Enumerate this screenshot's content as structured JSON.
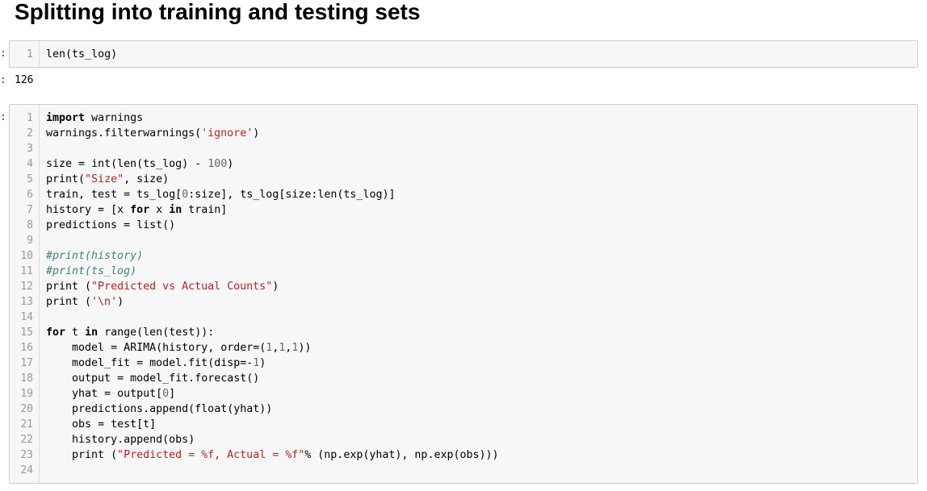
{
  "heading": "Splitting into training and testing sets",
  "cells": [
    {
      "prompt": ":",
      "lines": [
        {
          "n": "1",
          "code": "len(ts_log)"
        }
      ]
    },
    {
      "prompt": ":",
      "lines": [
        {
          "n": "1",
          "code": "import warnings"
        },
        {
          "n": "2",
          "code": "warnings.filterwarnings('ignore')"
        },
        {
          "n": "3",
          "code": ""
        },
        {
          "n": "4",
          "code": "size = int(len(ts_log) - 100)"
        },
        {
          "n": "5",
          "code": "print(\"Size\", size)"
        },
        {
          "n": "6",
          "code": "train, test = ts_log[0:size], ts_log[size:len(ts_log)]"
        },
        {
          "n": "7",
          "code": "history = [x for x in train]"
        },
        {
          "n": "8",
          "code": "predictions = list()"
        },
        {
          "n": "9",
          "code": ""
        },
        {
          "n": "10",
          "code": "#print(history)"
        },
        {
          "n": "11",
          "code": "#print(ts_log)"
        },
        {
          "n": "12",
          "code": "print (\"Predicted vs Actual Counts\")"
        },
        {
          "n": "13",
          "code": "print ('\\n')"
        },
        {
          "n": "14",
          "code": ""
        },
        {
          "n": "15",
          "code": "for t in range(len(test)):"
        },
        {
          "n": "16",
          "code": "    model = ARIMA(history, order=(1,1,1))"
        },
        {
          "n": "17",
          "code": "    model_fit = model.fit(disp=-1)"
        },
        {
          "n": "18",
          "code": "    output = model_fit.forecast()"
        },
        {
          "n": "19",
          "code": "    yhat = output[0]"
        },
        {
          "n": "20",
          "code": "    predictions.append(float(yhat))"
        },
        {
          "n": "21",
          "code": "    obs = test[t]"
        },
        {
          "n": "22",
          "code": "    history.append(obs)"
        },
        {
          "n": "23",
          "code": "    print (\"Predicted = %f, Actual = %f\"% (np.exp(yhat), np.exp(obs)))"
        },
        {
          "n": "24",
          "code": ""
        }
      ]
    }
  ],
  "output": {
    "prompt": ":",
    "text": "126"
  }
}
